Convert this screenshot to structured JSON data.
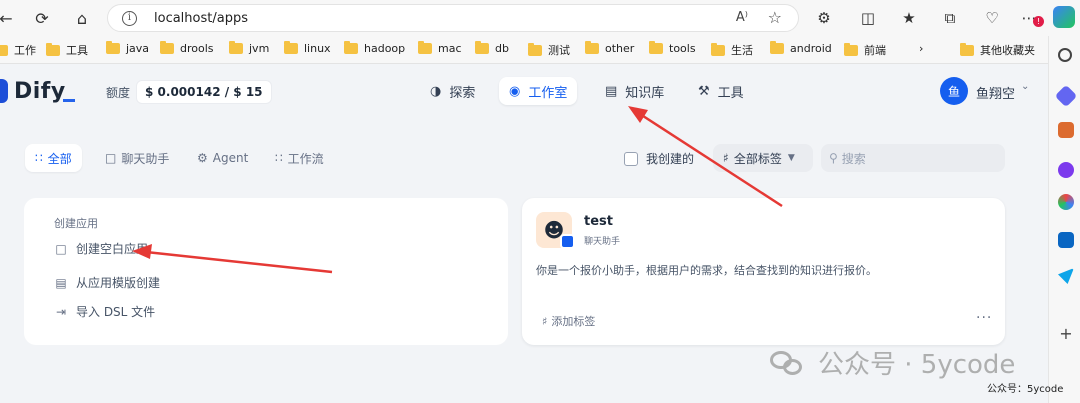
{
  "browser": {
    "url": "localhost/apps",
    "read_aloud_label": "A⁾",
    "notification_count": "!"
  },
  "bookmarks": [
    "工作",
    "工具",
    "java",
    "drools",
    "jvm",
    "linux",
    "hadoop",
    "mac",
    "db",
    "测试",
    "other",
    "tools",
    "生活",
    "android",
    "前端",
    "其他收藏夹"
  ],
  "app_header": {
    "logo": "Dify",
    "credit_label": "额度",
    "credit_value": "$ 0.000142 / $ 15",
    "nav": [
      {
        "label": "探索",
        "icon": "explore-icon"
      },
      {
        "label": "工作室",
        "icon": "robot-icon"
      },
      {
        "label": "知识库",
        "icon": "book-icon"
      },
      {
        "label": "工具",
        "icon": "hammer-icon"
      }
    ],
    "avatar_initial": "鱼",
    "username": "鱼翔空"
  },
  "filters": {
    "tabs": [
      {
        "label": "全部",
        "icon": "grid-icon"
      },
      {
        "label": "聊天助手",
        "icon": "chat-icon"
      },
      {
        "label": "Agent",
        "icon": "agent-icon"
      },
      {
        "label": "工作流",
        "icon": "workflow-icon"
      }
    ],
    "mine_label": "我创建的",
    "tag_select": "全部标签",
    "search_placeholder": "搜索"
  },
  "create_card": {
    "title": "创建应用",
    "items": [
      {
        "label": "创建空白应用",
        "icon": "file-plus-icon"
      },
      {
        "label": "从应用模版创建",
        "icon": "template-icon"
      },
      {
        "label": "导入 DSL 文件",
        "icon": "import-icon"
      }
    ]
  },
  "app_card": {
    "name": "test",
    "type": "聊天助手",
    "description": "你是一个报价小助手，根据用户的需求，结合查找到的知识进行报价。",
    "add_tag": "添加标签",
    "more": "···"
  },
  "watermark": {
    "big": "公众号 · 5ycode",
    "small": "公众号：5ycode"
  },
  "colors": {
    "accent": "#155eef",
    "arrow": "#e53935"
  }
}
